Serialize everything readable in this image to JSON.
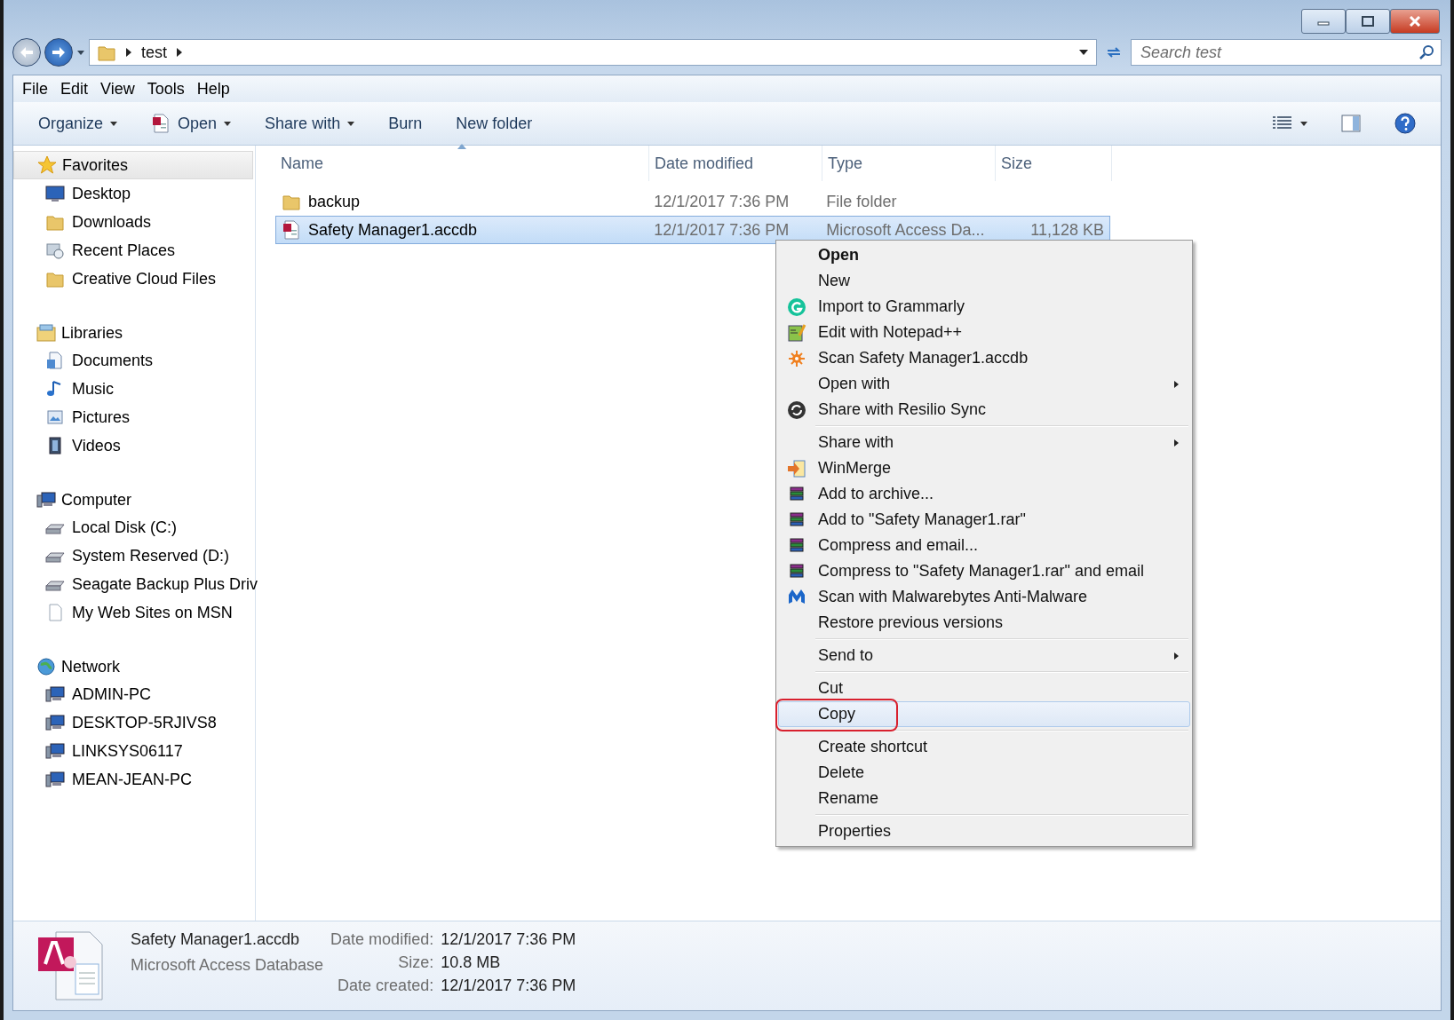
{
  "address_bar": {
    "path": [
      "test"
    ],
    "search": {
      "placeholder": "Search test"
    }
  },
  "menu_bar": [
    "File",
    "Edit",
    "View",
    "Tools",
    "Help"
  ],
  "toolbar": [
    {
      "label": "Organize",
      "dropdown": true,
      "kind": "plain"
    },
    {
      "label": "Open",
      "dropdown": true,
      "kind": "app"
    },
    {
      "label": "Share with",
      "dropdown": true,
      "kind": "plain"
    },
    {
      "label": "Burn",
      "dropdown": false,
      "kind": "plain"
    },
    {
      "label": "New folder",
      "dropdown": false,
      "kind": "plain"
    }
  ],
  "sidebar": [
    {
      "label": "Favorites",
      "kind": "star",
      "selected": true,
      "items": [
        {
          "label": "Desktop",
          "kind": "monitor"
        },
        {
          "label": "Downloads",
          "kind": "folder"
        },
        {
          "label": "Recent Places",
          "kind": "recent"
        },
        {
          "label": "Creative Cloud Files",
          "kind": "folder"
        }
      ]
    },
    {
      "label": "Libraries",
      "kind": "library",
      "selected": false,
      "items": [
        {
          "label": "Documents",
          "kind": "document"
        },
        {
          "label": "Music",
          "kind": "music"
        },
        {
          "label": "Pictures",
          "kind": "picture"
        },
        {
          "label": "Videos",
          "kind": "video"
        }
      ]
    },
    {
      "label": "Computer",
      "kind": "computer",
      "selected": false,
      "items": [
        {
          "label": "Local Disk (C:)",
          "kind": "disk"
        },
        {
          "label": "System Reserved (D:)",
          "kind": "disk"
        },
        {
          "label": "Seagate Backup Plus Driv",
          "kind": "disk"
        },
        {
          "label": "My Web Sites on MSN",
          "kind": "page"
        }
      ]
    },
    {
      "label": "Network",
      "kind": "globe",
      "selected": false,
      "items": [
        {
          "label": "ADMIN-PC",
          "kind": "computer"
        },
        {
          "label": "DESKTOP-5RJIVS8",
          "kind": "computer"
        },
        {
          "label": "LINKSYS06117",
          "kind": "computer"
        },
        {
          "label": "MEAN-JEAN-PC",
          "kind": "computer"
        }
      ]
    }
  ],
  "file_list": {
    "columns": [
      {
        "label": "Name",
        "sorted": true
      },
      {
        "label": "Date modified",
        "sorted": false
      },
      {
        "label": "Type",
        "sorted": false
      },
      {
        "label": "Size",
        "sorted": false
      }
    ],
    "rows": [
      {
        "name": "backup",
        "date_modified": "12/1/2017 7:36 PM",
        "type": "File folder",
        "kind": "folder",
        "selected": false
      },
      {
        "name": "Safety Manager1.accdb",
        "date_modified": "12/1/2017 7:36 PM",
        "type": "Microsoft Access Da...",
        "size": "11,128 KB",
        "kind": "access",
        "selected": true
      }
    ]
  },
  "context_menu": [
    [
      {
        "label": "Open",
        "kind": "none",
        "default": true,
        "submenu": false,
        "selected": false,
        "circled": false
      },
      {
        "label": "New",
        "kind": "none",
        "default": false,
        "submenu": false,
        "selected": false,
        "circled": false
      },
      {
        "label": "Import to Grammarly",
        "kind": "gcircle",
        "default": false,
        "submenu": false,
        "selected": false,
        "circled": false
      },
      {
        "label": "Edit with Notepad++",
        "kind": "notepad",
        "default": false,
        "submenu": false,
        "selected": false,
        "circled": false
      },
      {
        "label": "Scan Safety Manager1.accdb",
        "kind": "splat",
        "default": false,
        "submenu": false,
        "selected": false,
        "circled": false
      },
      {
        "label": "Open with",
        "kind": "none",
        "default": false,
        "submenu": true,
        "selected": false,
        "circled": false
      },
      {
        "label": "Share with Resilio Sync",
        "kind": "sync",
        "default": false,
        "submenu": false,
        "selected": false,
        "circled": false
      }
    ],
    [
      {
        "label": "Share with",
        "kind": "none",
        "default": false,
        "submenu": true,
        "selected": false,
        "circled": false
      },
      {
        "label": "WinMerge",
        "kind": "merge",
        "default": false,
        "submenu": false,
        "selected": false,
        "circled": false
      },
      {
        "label": "Add to archive...",
        "kind": "books",
        "default": false,
        "submenu": false,
        "selected": false,
        "circled": false
      },
      {
        "label": "Add to \"Safety Manager1.rar\"",
        "kind": "books",
        "default": false,
        "submenu": false,
        "selected": false,
        "circled": false
      },
      {
        "label": "Compress and email...",
        "kind": "books",
        "default": false,
        "submenu": false,
        "selected": false,
        "circled": false
      },
      {
        "label": "Compress to \"Safety Manager1.rar\" and email",
        "kind": "books",
        "default": false,
        "submenu": false,
        "selected": false,
        "circled": false
      },
      {
        "label": "Scan with Malwarebytes Anti-Malware",
        "kind": "mlogo",
        "default": false,
        "submenu": false,
        "selected": false,
        "circled": false
      },
      {
        "label": "Restore previous versions",
        "kind": "none",
        "default": false,
        "submenu": false,
        "selected": false,
        "circled": false
      }
    ],
    [
      {
        "label": "Send to",
        "kind": "none",
        "default": false,
        "submenu": true,
        "selected": false,
        "circled": false
      }
    ],
    [
      {
        "label": "Cut",
        "kind": "none",
        "default": false,
        "submenu": false,
        "selected": false,
        "circled": false
      },
      {
        "label": "Copy",
        "kind": "none",
        "default": false,
        "submenu": false,
        "selected": true,
        "circled": true
      }
    ],
    [
      {
        "label": "Create shortcut",
        "kind": "none",
        "default": false,
        "submenu": false,
        "selected": false,
        "circled": false
      },
      {
        "label": "Delete",
        "kind": "none",
        "default": false,
        "submenu": false,
        "selected": false,
        "circled": false
      },
      {
        "label": "Rename",
        "kind": "none",
        "default": false,
        "submenu": false,
        "selected": false,
        "circled": false
      }
    ],
    [
      {
        "label": "Properties",
        "kind": "none",
        "default": false,
        "submenu": false,
        "selected": false,
        "circled": false
      }
    ]
  ],
  "details_pane": {
    "name": "Safety Manager1.accdb",
    "type": "Microsoft Access Database",
    "fields": [
      {
        "label": "Date modified:",
        "value": "12/1/2017 7:36 PM"
      },
      {
        "label": "Size:",
        "value": "10.8 MB"
      },
      {
        "label": "Date created:",
        "value": "12/1/2017 7:36 PM"
      }
    ]
  }
}
